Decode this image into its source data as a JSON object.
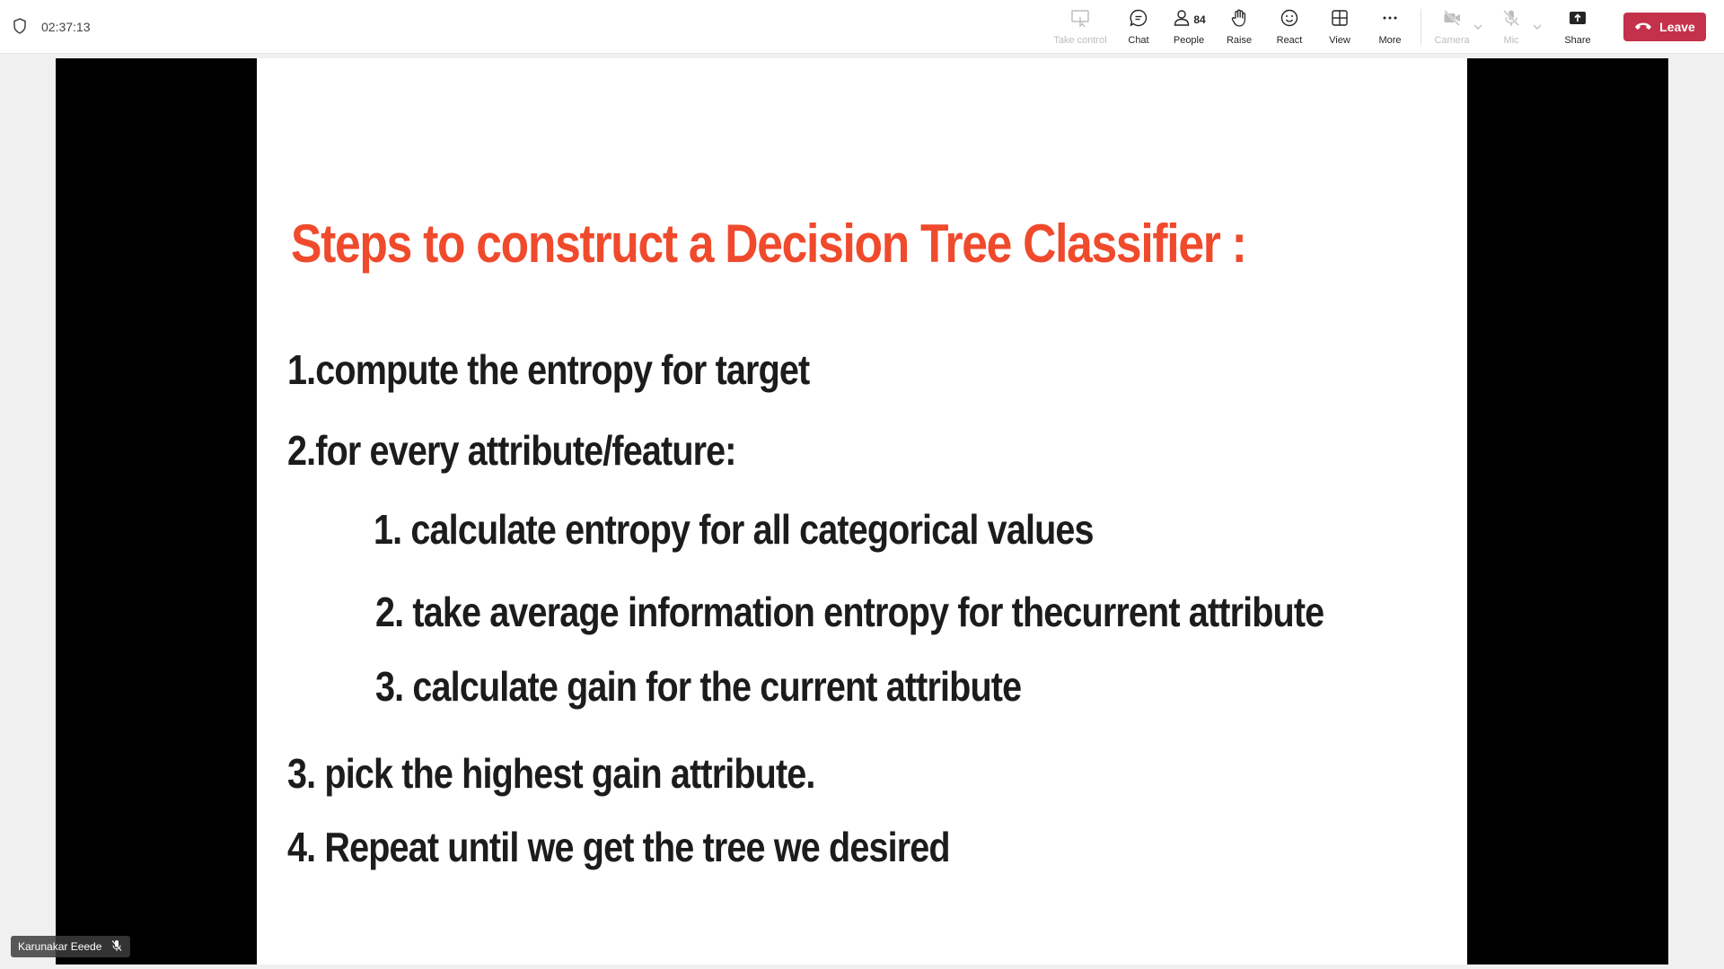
{
  "meeting": {
    "elapsed_time": "02:37:13"
  },
  "toolbar": {
    "take_control": "Take control",
    "chat": "Chat",
    "people": "People",
    "people_count": "84",
    "raise": "Raise",
    "react": "React",
    "view": "View",
    "more": "More",
    "camera": "Camera",
    "mic": "Mic",
    "share": "Share",
    "leave": "Leave"
  },
  "colors": {
    "leave_button": "#c4314b",
    "slide_title": "#f04a2c"
  },
  "slide": {
    "title": "Steps to construct a Decision Tree Classifier :",
    "lines": [
      "1.compute the entropy for target",
      "2.for every attribute/feature:",
      "1. calculate entropy for all categorical values",
      "2. take average information entropy for thecurrent attribute",
      "3. calculate gain for the current attribute",
      "3. pick the highest gain attribute.",
      "4. Repeat until we get the tree we desired"
    ]
  },
  "participant": {
    "name": "Karunakar Eeede",
    "mic_icon": "mic-off-icon"
  }
}
